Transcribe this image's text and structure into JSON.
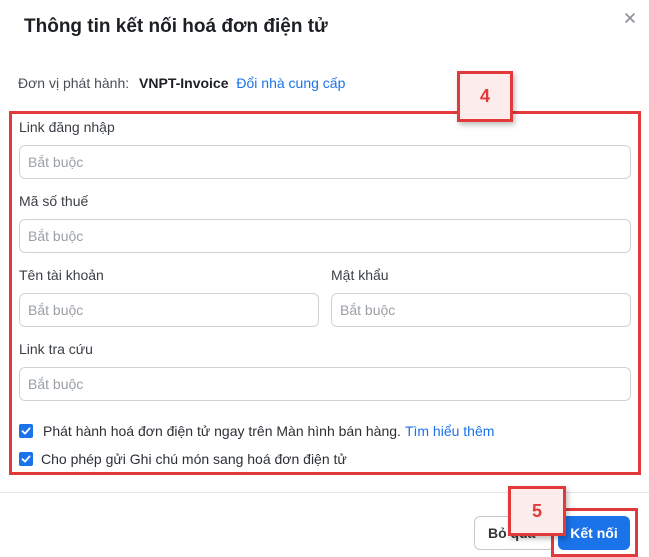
{
  "dialog": {
    "title": "Thông tin kết nối hoá đơn điện tử",
    "issuer_label": "Đơn vị phát hành:",
    "issuer_value": "VNPT-Invoice",
    "change_provider_link": "Đổi nhà cung cấp"
  },
  "form": {
    "login_link": {
      "label": "Link đăng nhập",
      "placeholder": "Bắt buộc"
    },
    "tax_code": {
      "label": "Mã số thuế",
      "placeholder": "Bắt buộc"
    },
    "account_name": {
      "label": "Tên tài khoản",
      "placeholder": "Bắt buộc"
    },
    "password": {
      "label": "Mật khẩu",
      "placeholder": "Bắt buộc"
    },
    "lookup_link": {
      "label": "Link tra cứu",
      "placeholder": "Bắt buộc"
    },
    "option_issue_on_sales": {
      "checked": true,
      "label": "Phát hành hoá đơn điện tử ngay trên Màn hình bán hàng.",
      "link": "Tìm hiểu thêm"
    },
    "option_send_notes": {
      "checked": true,
      "label": "Cho phép gửi Ghi chú món sang hoá đơn điện tử"
    }
  },
  "annotations": {
    "step_form": "4",
    "step_connect": "5"
  },
  "footer": {
    "cancel_label": "Bỏ qua",
    "connect_label": "Kết nối"
  },
  "colors": {
    "accent": "#1a73e8",
    "annotation_red": "#e03a3a"
  }
}
